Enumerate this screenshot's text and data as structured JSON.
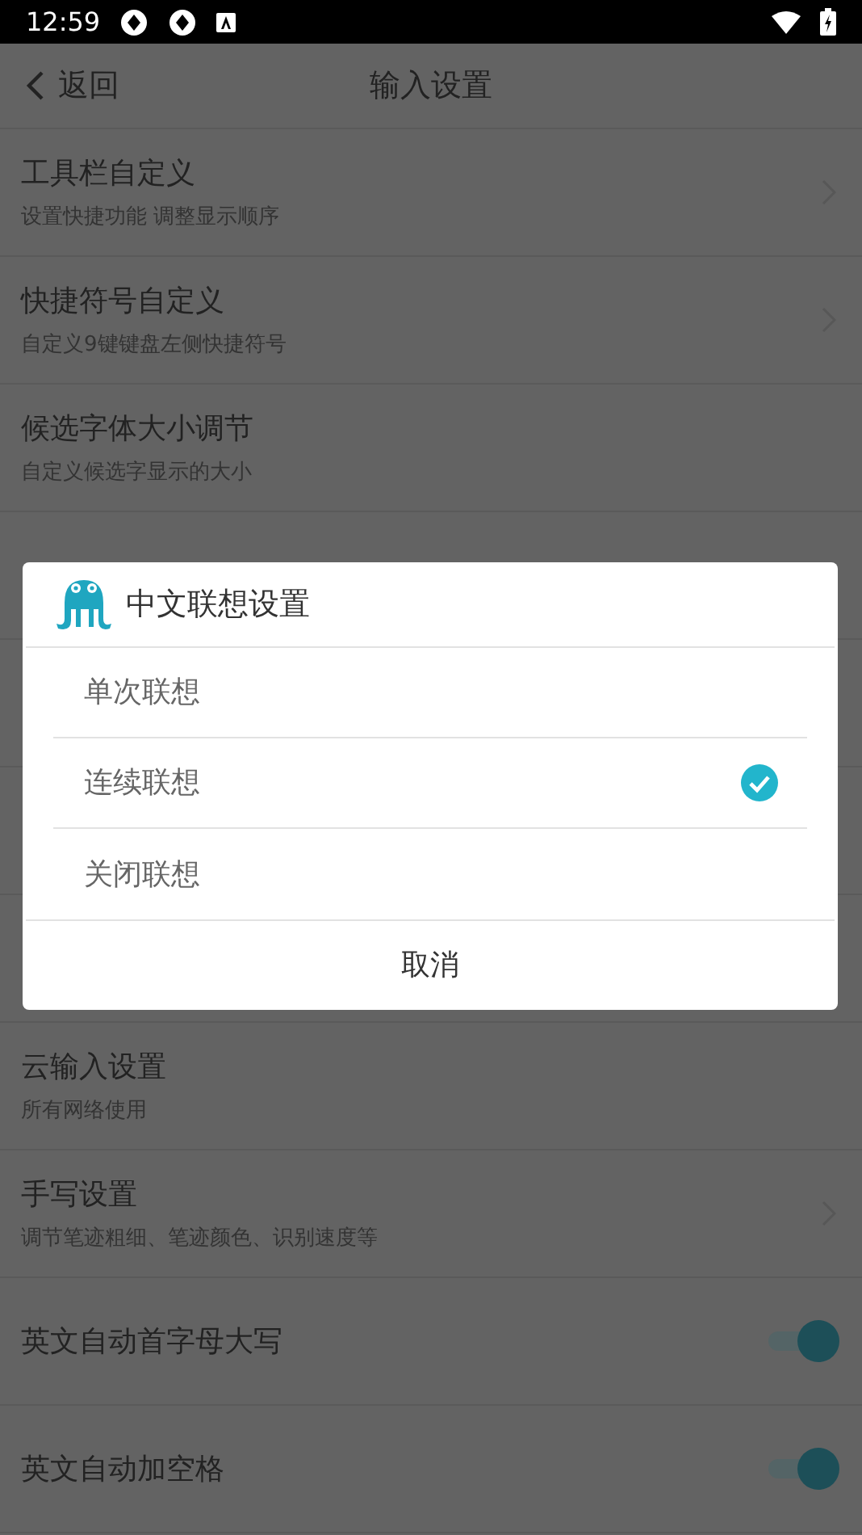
{
  "status_bar": {
    "time": "12:59"
  },
  "header": {
    "back_label": "返回",
    "title": "输入设置"
  },
  "settings": [
    {
      "kind": "link",
      "title": "工具栏自定义",
      "subtitle": "设置快捷功能 调整显示顺序"
    },
    {
      "kind": "link",
      "title": "快捷符号自定义",
      "subtitle": "自定义9键键盘左侧快捷符号"
    },
    {
      "kind": "plain",
      "title": "候选字体大小调节",
      "subtitle": "自定义候选字显示的大小"
    },
    {
      "kind": "hidden"
    },
    {
      "kind": "hidden"
    },
    {
      "kind": "hidden"
    },
    {
      "kind": "hidden"
    },
    {
      "kind": "plain",
      "title": "云输入设置",
      "subtitle": "所有网络使用"
    },
    {
      "kind": "link",
      "title": "手写设置",
      "subtitle": "调节笔迹粗细、笔迹颜色、识别速度等"
    },
    {
      "kind": "toggle",
      "title": "英文自动首字母大写",
      "on": true
    },
    {
      "kind": "toggle",
      "title": "英文自动加空格",
      "on": true
    }
  ],
  "dialog": {
    "title": "中文联想设置",
    "options": [
      {
        "label": "单次联想",
        "selected": false
      },
      {
        "label": "连续联想",
        "selected": true
      },
      {
        "label": "关闭联想",
        "selected": false
      }
    ],
    "cancel": "取消"
  }
}
